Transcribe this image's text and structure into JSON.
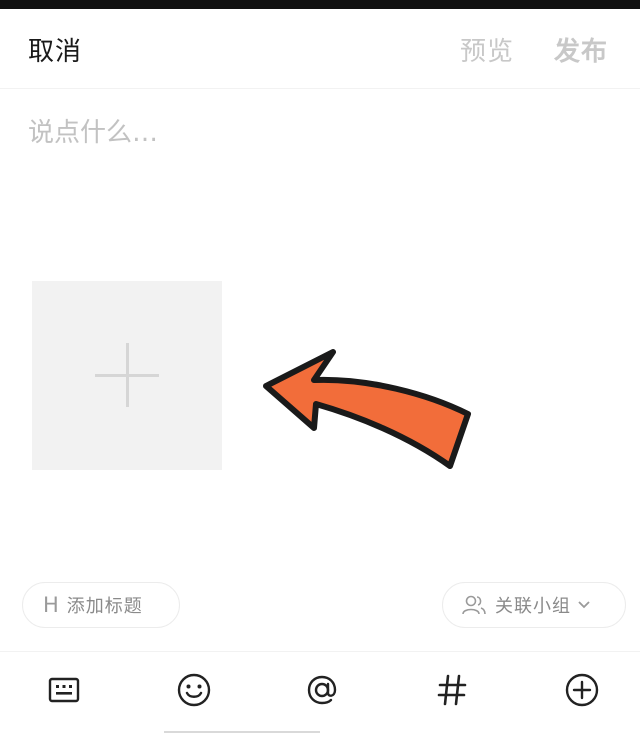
{
  "header": {
    "cancel_label": "取消",
    "preview_label": "预览",
    "publish_label": "发布"
  },
  "composer": {
    "placeholder": "说点什么…",
    "value": ""
  },
  "media": {
    "add_icon": "plus-icon"
  },
  "chips": {
    "title_icon": "H",
    "title_label": "添加标题",
    "group_label": "关联小组",
    "group_icon": "people-icon"
  },
  "toolbar": {
    "items": [
      "keyboard-icon",
      "emoji-icon",
      "at-sign-icon",
      "hashtag-icon",
      "add-circle-icon"
    ]
  },
  "colors": {
    "arrow_fill": "#f26d3a",
    "arrow_outline": "#1a1a1a",
    "tile_bg": "#f2f2f2",
    "muted_text": "#c8c8c8"
  }
}
